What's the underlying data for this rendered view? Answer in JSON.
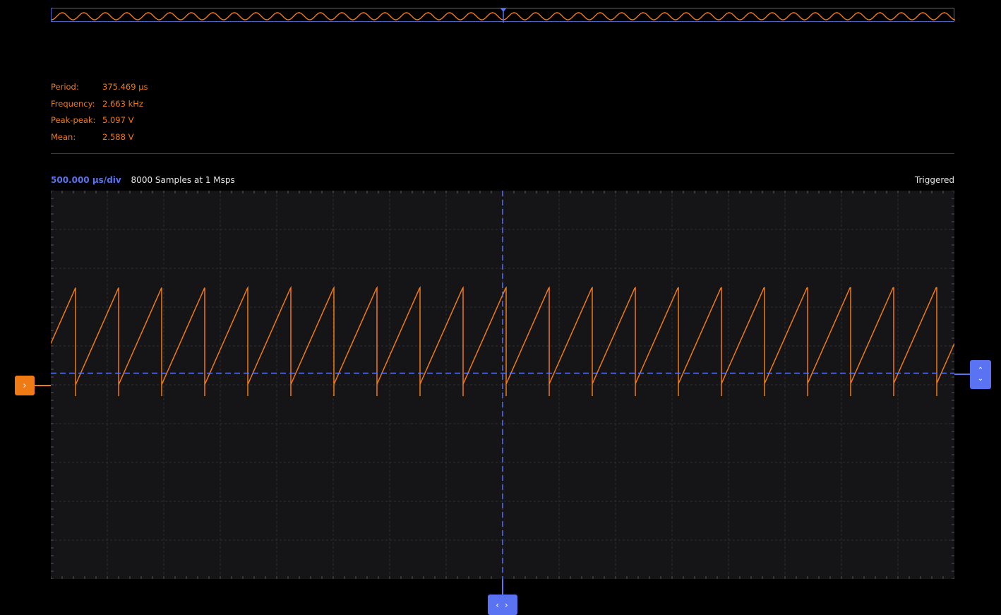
{
  "measurements": [
    {
      "label": "Period:",
      "value": "375.469 μs"
    },
    {
      "label": "Frequency:",
      "value": "2.663 kHz"
    },
    {
      "label": "Peak-peak:",
      "value": "5.097 V"
    },
    {
      "label": "Mean:",
      "value": "2.588 V"
    }
  ],
  "infobar": {
    "timebase": "500.000 μs/div",
    "samples": "8000 Samples at 1 Msps",
    "status": "Triggered"
  },
  "controls": {
    "channel_offset_icon": "chevron-right-icon",
    "channel_offset_glyph": "›",
    "trigger_level_icon": "chevron-up-down-icon",
    "trigger_level_up": "⌃",
    "trigger_level_down": "⌄",
    "trigger_position_icon": "chevron-left-right-icon",
    "trigger_position_glyph": "‹ ›"
  },
  "colors": {
    "background": "#000000",
    "plot_background": "#151517",
    "channel": "#f07a14",
    "accent": "#5a73f2",
    "grid": "#2e2e30",
    "text": "#e6e6e6"
  },
  "chart_data": {
    "type": "line",
    "waveform": "sawtooth",
    "horizontal_divisions": 16,
    "vertical_divisions": 10,
    "cycles_in_view": 21,
    "low_level_fraction": 0.5,
    "high_level_fraction": 0.25,
    "trigger_level_fraction": 0.47
  }
}
